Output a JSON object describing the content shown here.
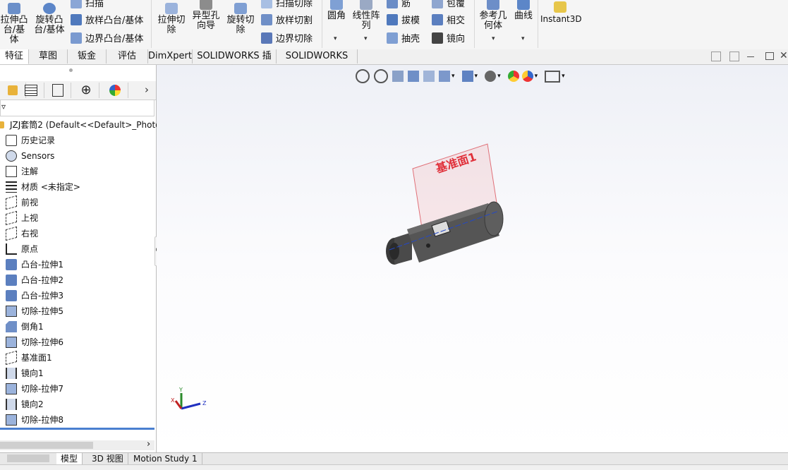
{
  "ribbon": {
    "boss_extrude": "拉伸凸台/基体",
    "revolve_boss": "旋转凸台/基体",
    "sweep": "扫描",
    "loft_boss": "放样凸台/基体",
    "boundary_boss": "边界凸台/基体",
    "cut_extrude": "拉伸切除",
    "hole_wizard": "异型孔向导",
    "revolve_cut": "旋转切除",
    "sweep_cut": "扫描切除",
    "loft_cut": "放样切割",
    "boundary_cut": "边界切除",
    "fillet": "圆角",
    "linear_pattern": "线性阵列",
    "rib": "筋",
    "draft": "拔模",
    "shell": "抽壳",
    "wrap": "包覆",
    "intersect": "相交",
    "mirror": "镜向",
    "ref_geometry": "参考几何体",
    "curves": "曲线",
    "instant3d": "Instant3D"
  },
  "tabs": [
    "特征",
    "草图",
    "钣金",
    "评估",
    "DimXpert",
    "SOLIDWORKS 插件",
    "SOLIDWORKS MBD"
  ],
  "tree": {
    "root": "JZJ套筒2 (Default<<Default>_Photo",
    "items": [
      {
        "label": "历史记录",
        "icon": "history-icon"
      },
      {
        "label": "Sensors",
        "icon": "sensors-icon"
      },
      {
        "label": "注解",
        "icon": "annotation-icon"
      },
      {
        "label": "材质 <未指定>",
        "icon": "material-icon"
      },
      {
        "label": "前视",
        "icon": "plane-icon"
      },
      {
        "label": "上视",
        "icon": "plane-icon"
      },
      {
        "label": "右视",
        "icon": "plane-icon"
      },
      {
        "label": "原点",
        "icon": "origin-icon"
      },
      {
        "label": "凸台-拉伸1",
        "icon": "boss-extrude-icon"
      },
      {
        "label": "凸台-拉伸2",
        "icon": "boss-extrude-icon"
      },
      {
        "label": "凸台-拉伸3",
        "icon": "boss-extrude-icon"
      },
      {
        "label": "切除-拉伸5",
        "icon": "cut-extrude-icon"
      },
      {
        "label": "倒角1",
        "icon": "chamfer-icon"
      },
      {
        "label": "切除-拉伸6",
        "icon": "cut-extrude-icon"
      },
      {
        "label": "基准面1",
        "icon": "plane-icon"
      },
      {
        "label": "镜向1",
        "icon": "mirror-icon"
      },
      {
        "label": "切除-拉伸7",
        "icon": "cut-extrude-icon"
      },
      {
        "label": "镜向2",
        "icon": "mirror-icon"
      },
      {
        "label": "切除-拉伸8",
        "icon": "cut-extrude-icon"
      }
    ]
  },
  "viewport": {
    "plane_label": "基准面1",
    "axis_x": "X",
    "axis_y": "Y",
    "axis_z": "Z"
  },
  "bottom_tabs": [
    "模型",
    "3D 视图",
    "Motion Study 1"
  ],
  "colors": {
    "accent_blue": "#1c4fa8",
    "plane_label": "#e0303a",
    "part_body": "#4a4a4a"
  }
}
